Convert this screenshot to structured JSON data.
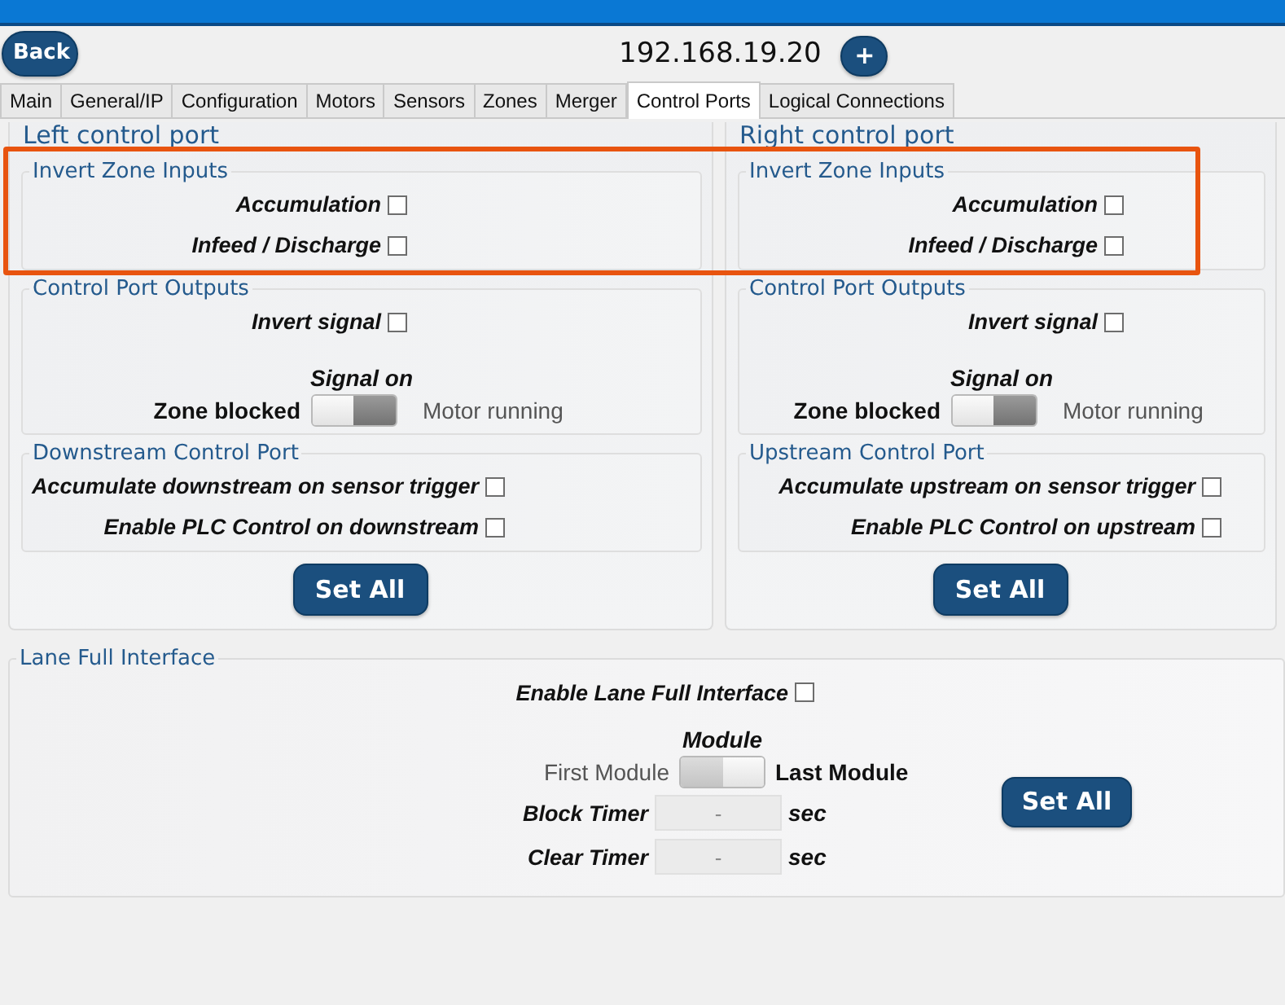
{
  "header": {
    "back_button": "Back",
    "title": "192.168.19.20",
    "add_button": "+"
  },
  "tabs": [
    {
      "label": "Main",
      "selected": false
    },
    {
      "label": "General/IP",
      "selected": false
    },
    {
      "label": "Configuration",
      "selected": false
    },
    {
      "label": "Motors",
      "selected": false
    },
    {
      "label": "Sensors",
      "selected": false
    },
    {
      "label": "Zones",
      "selected": false
    },
    {
      "label": "Merger",
      "selected": false
    },
    {
      "label": "Control Ports",
      "selected": true
    },
    {
      "label": "Logical Connections",
      "selected": false
    }
  ],
  "ports": [
    {
      "title": "Left control port",
      "groups": [
        {
          "kind": "inputs",
          "title": "Invert Zone Inputs",
          "items": [
            {
              "label": "Accumulation",
              "checked": false
            },
            {
              "label": "Infeed / Discharge",
              "checked": false
            }
          ]
        },
        {
          "kind": "outputs",
          "title": "Control Port Outputs",
          "items": [
            {
              "label": "Invert signal",
              "checked": false
            }
          ],
          "toggle": {
            "caption": "Signal on",
            "left_label": "Zone blocked",
            "right_label": "Motor running",
            "on": false
          }
        },
        {
          "kind": "port",
          "title": "Downstream Control Port",
          "items": [
            {
              "label": "Accumulate downstream on sensor trigger",
              "checked": false
            },
            {
              "label": "Enable PLC Control on downstream",
              "checked": false
            }
          ]
        }
      ],
      "button": "Set All"
    },
    {
      "title": "Right control port",
      "groups": [
        {
          "kind": "inputs",
          "title": "Invert Zone Inputs",
          "items": [
            {
              "label": "Accumulation",
              "checked": false
            },
            {
              "label": "Infeed / Discharge",
              "checked": false
            }
          ]
        },
        {
          "kind": "outputs",
          "title": "Control Port Outputs",
          "items": [
            {
              "label": "Invert signal",
              "checked": false
            }
          ],
          "toggle": {
            "caption": "Signal on",
            "left_label": "Zone blocked",
            "right_label": "Motor running",
            "on": false
          }
        },
        {
          "kind": "port",
          "title": "Upstream Control Port",
          "items": [
            {
              "label": "Accumulate upstream on sensor trigger",
              "checked": false
            },
            {
              "label": "Enable PLC Control on upstream",
              "checked": false
            }
          ]
        }
      ],
      "button": "Set All"
    }
  ],
  "highlight": {
    "kind": "rectangle"
  },
  "lane_full": {
    "title": "Lane Full Interface",
    "enable": {
      "label": "Enable Lane Full Interface",
      "checked": false
    },
    "module": {
      "caption": "Module",
      "left_label": "First Module",
      "right_label": "Last Module",
      "on": true
    },
    "timers": [
      {
        "label": "Block Timer",
        "value": "-",
        "unit": "sec"
      },
      {
        "label": "Clear Timer",
        "value": "-",
        "unit": "sec"
      }
    ],
    "button": "Set All"
  }
}
